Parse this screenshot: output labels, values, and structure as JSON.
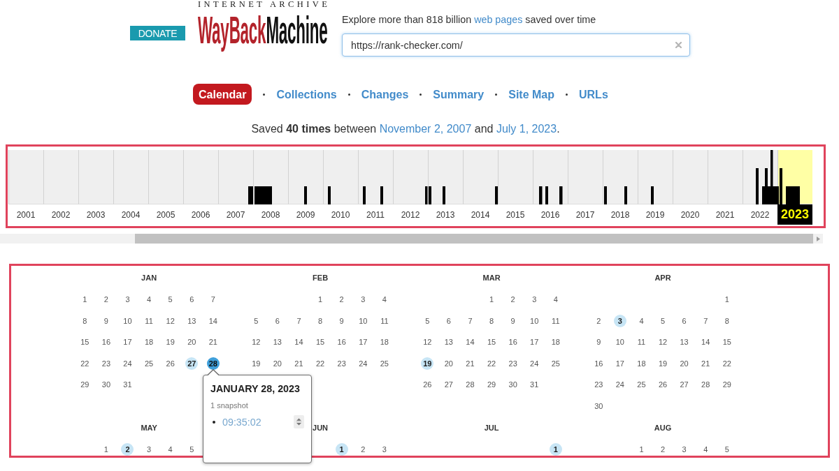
{
  "header": {
    "donate_button": "DONATE",
    "logo": {
      "wordmark": "INTERNET ARCHIVE",
      "name_part_1": "WayBack",
      "name_part_2": "Machine"
    },
    "tagline": [
      {
        "kind": "text",
        "text": "Explore more than 818 billion "
      },
      {
        "kind": "link",
        "text": "web pages"
      },
      {
        "kind": "text",
        "text": " saved over time"
      }
    ],
    "search": {
      "value": "https://rank-checker.com/"
    }
  },
  "tabs": [
    {
      "label": "Calendar",
      "selected": true
    },
    {
      "label": "Collections",
      "selected": false
    },
    {
      "label": "Changes",
      "selected": false
    },
    {
      "label": "Summary",
      "selected": false
    },
    {
      "label": "Site Map",
      "selected": false
    },
    {
      "label": "URLs",
      "selected": false
    }
  ],
  "summary": [
    {
      "kind": "text",
      "text": "Saved **40 times** between "
    },
    {
      "kind": "link",
      "text": "November 2, 2007"
    },
    {
      "kind": "text",
      "text": " and "
    },
    {
      "kind": "link",
      "text": "July 1, 2023"
    },
    {
      "kind": "text",
      "text": "."
    }
  ],
  "timeline": {
    "years": [
      {
        "label": "2001",
        "selected": false
      },
      {
        "label": "2002",
        "selected": false
      },
      {
        "label": "2003",
        "selected": false
      },
      {
        "label": "2004",
        "selected": false
      },
      {
        "label": "2005",
        "selected": false
      },
      {
        "label": "2006",
        "selected": false
      },
      {
        "label": "2007",
        "selected": false
      },
      {
        "label": "2008",
        "selected": false
      },
      {
        "label": "2009",
        "selected": false
      },
      {
        "label": "2010",
        "selected": false
      },
      {
        "label": "2011",
        "selected": false
      },
      {
        "label": "2012",
        "selected": false
      },
      {
        "label": "2013",
        "selected": false
      },
      {
        "label": "2014",
        "selected": false
      },
      {
        "label": "2015",
        "selected": false
      },
      {
        "label": "2016",
        "selected": false
      },
      {
        "label": "2017",
        "selected": false
      },
      {
        "label": "2018",
        "selected": false
      },
      {
        "label": "2019",
        "selected": false
      },
      {
        "label": "2020",
        "selected": false
      },
      {
        "label": "2021",
        "selected": false
      },
      {
        "label": "2022",
        "selected": false
      },
      {
        "label": "2023",
        "selected": true
      }
    ]
  },
  "calendar": {
    "months": [
      {
        "name": "JAN",
        "cells": [
          {
            "kind": "day",
            "day": "1",
            "captured": false,
            "selected": false
          },
          {
            "kind": "day",
            "day": "2",
            "captured": false,
            "selected": false
          },
          {
            "kind": "day",
            "day": "3",
            "captured": false,
            "selected": false
          },
          {
            "kind": "day",
            "day": "4",
            "captured": false,
            "selected": false
          },
          {
            "kind": "day",
            "day": "5",
            "captured": false,
            "selected": false
          },
          {
            "kind": "day",
            "day": "6",
            "captured": false,
            "selected": false
          },
          {
            "kind": "day",
            "day": "7",
            "captured": false,
            "selected": false
          },
          {
            "kind": "day",
            "day": "8",
            "captured": false,
            "selected": false
          },
          {
            "kind": "day",
            "day": "9",
            "captured": false,
            "selected": false
          },
          {
            "kind": "day",
            "day": "10",
            "captured": false,
            "selected": false
          },
          {
            "kind": "day",
            "day": "11",
            "captured": false,
            "selected": false
          },
          {
            "kind": "day",
            "day": "12",
            "captured": false,
            "selected": false
          },
          {
            "kind": "day",
            "day": "13",
            "captured": false,
            "selected": false
          },
          {
            "kind": "day",
            "day": "14",
            "captured": false,
            "selected": false
          },
          {
            "kind": "day",
            "day": "15",
            "captured": false,
            "selected": false
          },
          {
            "kind": "day",
            "day": "16",
            "captured": false,
            "selected": false
          },
          {
            "kind": "day",
            "day": "17",
            "captured": false,
            "selected": false
          },
          {
            "kind": "day",
            "day": "18",
            "captured": false,
            "selected": false
          },
          {
            "kind": "day",
            "day": "19",
            "captured": false,
            "selected": false
          },
          {
            "kind": "day",
            "day": "20",
            "captured": false,
            "selected": false
          },
          {
            "kind": "day",
            "day": "21",
            "captured": false,
            "selected": false
          },
          {
            "kind": "day",
            "day": "22",
            "captured": false,
            "selected": false
          },
          {
            "kind": "day",
            "day": "23",
            "captured": false,
            "selected": false
          },
          {
            "kind": "day",
            "day": "24",
            "captured": false,
            "selected": false
          },
          {
            "kind": "day",
            "day": "25",
            "captured": false,
            "selected": false
          },
          {
            "kind": "day",
            "day": "26",
            "captured": false,
            "selected": false
          },
          {
            "kind": "day",
            "day": "27",
            "captured": true,
            "selected": false
          },
          {
            "kind": "day",
            "day": "28",
            "captured": true,
            "selected": true
          },
          {
            "kind": "day",
            "day": "29",
            "captured": false,
            "selected": false
          },
          {
            "kind": "day",
            "day": "30",
            "captured": false,
            "selected": false
          },
          {
            "kind": "day",
            "day": "31",
            "captured": false,
            "selected": false
          }
        ]
      },
      {
        "name": "FEB",
        "cells": [
          {
            "kind": "blank"
          },
          {
            "kind": "blank"
          },
          {
            "kind": "blank"
          },
          {
            "kind": "day",
            "day": "1",
            "captured": false,
            "selected": false
          },
          {
            "kind": "day",
            "day": "2",
            "captured": false,
            "selected": false
          },
          {
            "kind": "day",
            "day": "3",
            "captured": false,
            "selected": false
          },
          {
            "kind": "day",
            "day": "4",
            "captured": false,
            "selected": false
          },
          {
            "kind": "day",
            "day": "5",
            "captured": false,
            "selected": false
          },
          {
            "kind": "day",
            "day": "6",
            "captured": false,
            "selected": false
          },
          {
            "kind": "day",
            "day": "7",
            "captured": false,
            "selected": false
          },
          {
            "kind": "day",
            "day": "8",
            "captured": false,
            "selected": false
          },
          {
            "kind": "day",
            "day": "9",
            "captured": false,
            "selected": false
          },
          {
            "kind": "day",
            "day": "10",
            "captured": false,
            "selected": false
          },
          {
            "kind": "day",
            "day": "11",
            "captured": false,
            "selected": false
          },
          {
            "kind": "day",
            "day": "12",
            "captured": false,
            "selected": false
          },
          {
            "kind": "day",
            "day": "13",
            "captured": false,
            "selected": false
          },
          {
            "kind": "day",
            "day": "14",
            "captured": false,
            "selected": false
          },
          {
            "kind": "day",
            "day": "15",
            "captured": false,
            "selected": false
          },
          {
            "kind": "day",
            "day": "16",
            "captured": false,
            "selected": false
          },
          {
            "kind": "day",
            "day": "17",
            "captured": false,
            "selected": false
          },
          {
            "kind": "day",
            "day": "18",
            "captured": false,
            "selected": false
          },
          {
            "kind": "day",
            "day": "19",
            "captured": false,
            "selected": false
          },
          {
            "kind": "day",
            "day": "20",
            "captured": false,
            "selected": false
          },
          {
            "kind": "day",
            "day": "21",
            "captured": false,
            "selected": false
          },
          {
            "kind": "day",
            "day": "22",
            "captured": false,
            "selected": false
          },
          {
            "kind": "day",
            "day": "23",
            "captured": false,
            "selected": false
          },
          {
            "kind": "day",
            "day": "24",
            "captured": false,
            "selected": false
          },
          {
            "kind": "day",
            "day": "25",
            "captured": false,
            "selected": false
          }
        ]
      },
      {
        "name": "MAR",
        "cells": [
          {
            "kind": "blank"
          },
          {
            "kind": "blank"
          },
          {
            "kind": "blank"
          },
          {
            "kind": "day",
            "day": "1",
            "captured": false,
            "selected": false
          },
          {
            "kind": "day",
            "day": "2",
            "captured": false,
            "selected": false
          },
          {
            "kind": "day",
            "day": "3",
            "captured": false,
            "selected": false
          },
          {
            "kind": "day",
            "day": "4",
            "captured": false,
            "selected": false
          },
          {
            "kind": "day",
            "day": "5",
            "captured": false,
            "selected": false
          },
          {
            "kind": "day",
            "day": "6",
            "captured": false,
            "selected": false
          },
          {
            "kind": "day",
            "day": "7",
            "captured": false,
            "selected": false
          },
          {
            "kind": "day",
            "day": "8",
            "captured": false,
            "selected": false
          },
          {
            "kind": "day",
            "day": "9",
            "captured": false,
            "selected": false
          },
          {
            "kind": "day",
            "day": "10",
            "captured": false,
            "selected": false
          },
          {
            "kind": "day",
            "day": "11",
            "captured": false,
            "selected": false
          },
          {
            "kind": "day",
            "day": "12",
            "captured": false,
            "selected": false
          },
          {
            "kind": "day",
            "day": "13",
            "captured": false,
            "selected": false
          },
          {
            "kind": "day",
            "day": "14",
            "captured": false,
            "selected": false
          },
          {
            "kind": "day",
            "day": "15",
            "captured": false,
            "selected": false
          },
          {
            "kind": "day",
            "day": "16",
            "captured": false,
            "selected": false
          },
          {
            "kind": "day",
            "day": "17",
            "captured": false,
            "selected": false
          },
          {
            "kind": "day",
            "day": "18",
            "captured": false,
            "selected": false
          },
          {
            "kind": "day",
            "day": "19",
            "captured": true,
            "selected": false
          },
          {
            "kind": "day",
            "day": "20",
            "captured": false,
            "selected": false
          },
          {
            "kind": "day",
            "day": "21",
            "captured": false,
            "selected": false
          },
          {
            "kind": "day",
            "day": "22",
            "captured": false,
            "selected": false
          },
          {
            "kind": "day",
            "day": "23",
            "captured": false,
            "selected": false
          },
          {
            "kind": "day",
            "day": "24",
            "captured": false,
            "selected": false
          },
          {
            "kind": "day",
            "day": "25",
            "captured": false,
            "selected": false
          },
          {
            "kind": "day",
            "day": "26",
            "captured": false,
            "selected": false
          },
          {
            "kind": "day",
            "day": "27",
            "captured": false,
            "selected": false
          },
          {
            "kind": "day",
            "day": "28",
            "captured": false,
            "selected": false
          },
          {
            "kind": "day",
            "day": "29",
            "captured": false,
            "selected": false
          },
          {
            "kind": "day",
            "day": "30",
            "captured": false,
            "selected": false
          },
          {
            "kind": "day",
            "day": "31",
            "captured": false,
            "selected": false
          }
        ]
      },
      {
        "name": "APR",
        "cells": [
          {
            "kind": "blank"
          },
          {
            "kind": "blank"
          },
          {
            "kind": "blank"
          },
          {
            "kind": "blank"
          },
          {
            "kind": "blank"
          },
          {
            "kind": "blank"
          },
          {
            "kind": "day",
            "day": "1",
            "captured": false,
            "selected": false
          },
          {
            "kind": "day",
            "day": "2",
            "captured": false,
            "selected": false
          },
          {
            "kind": "day",
            "day": "3",
            "captured": true,
            "selected": false
          },
          {
            "kind": "day",
            "day": "4",
            "captured": false,
            "selected": false
          },
          {
            "kind": "day",
            "day": "5",
            "captured": false,
            "selected": false
          },
          {
            "kind": "day",
            "day": "6",
            "captured": false,
            "selected": false
          },
          {
            "kind": "day",
            "day": "7",
            "captured": false,
            "selected": false
          },
          {
            "kind": "day",
            "day": "8",
            "captured": false,
            "selected": false
          },
          {
            "kind": "day",
            "day": "9",
            "captured": false,
            "selected": false
          },
          {
            "kind": "day",
            "day": "10",
            "captured": false,
            "selected": false
          },
          {
            "kind": "day",
            "day": "11",
            "captured": false,
            "selected": false
          },
          {
            "kind": "day",
            "day": "12",
            "captured": false,
            "selected": false
          },
          {
            "kind": "day",
            "day": "13",
            "captured": false,
            "selected": false
          },
          {
            "kind": "day",
            "day": "14",
            "captured": false,
            "selected": false
          },
          {
            "kind": "day",
            "day": "15",
            "captured": false,
            "selected": false
          },
          {
            "kind": "day",
            "day": "16",
            "captured": false,
            "selected": false
          },
          {
            "kind": "day",
            "day": "17",
            "captured": false,
            "selected": false
          },
          {
            "kind": "day",
            "day": "18",
            "captured": false,
            "selected": false
          },
          {
            "kind": "day",
            "day": "19",
            "captured": false,
            "selected": false
          },
          {
            "kind": "day",
            "day": "20",
            "captured": false,
            "selected": false
          },
          {
            "kind": "day",
            "day": "21",
            "captured": false,
            "selected": false
          },
          {
            "kind": "day",
            "day": "22",
            "captured": false,
            "selected": false
          },
          {
            "kind": "day",
            "day": "23",
            "captured": false,
            "selected": false
          },
          {
            "kind": "day",
            "day": "24",
            "captured": false,
            "selected": false
          },
          {
            "kind": "day",
            "day": "25",
            "captured": false,
            "selected": false
          },
          {
            "kind": "day",
            "day": "26",
            "captured": false,
            "selected": false
          },
          {
            "kind": "day",
            "day": "27",
            "captured": false,
            "selected": false
          },
          {
            "kind": "day",
            "day": "28",
            "captured": false,
            "selected": false
          },
          {
            "kind": "day",
            "day": "29",
            "captured": false,
            "selected": false
          },
          {
            "kind": "day",
            "day": "30",
            "captured": false,
            "selected": false
          }
        ]
      },
      {
        "name": "MAY",
        "cells": [
          {
            "kind": "blank"
          },
          {
            "kind": "day",
            "day": "1",
            "captured": false,
            "selected": false
          },
          {
            "kind": "day",
            "day": "2",
            "captured": true,
            "selected": false
          },
          {
            "kind": "day",
            "day": "3",
            "captured": false,
            "selected": false
          },
          {
            "kind": "day",
            "day": "4",
            "captured": false,
            "selected": false
          },
          {
            "kind": "day",
            "day": "5",
            "captured": false,
            "selected": false
          }
        ]
      },
      {
        "name": "JUN",
        "cells": [
          {
            "kind": "blank"
          },
          {
            "kind": "blank"
          },
          {
            "kind": "blank"
          },
          {
            "kind": "blank"
          },
          {
            "kind": "day",
            "day": "1",
            "captured": true,
            "selected": false
          },
          {
            "kind": "day",
            "day": "2",
            "captured": false,
            "selected": false
          },
          {
            "kind": "day",
            "day": "3",
            "captured": false,
            "selected": false
          }
        ]
      },
      {
        "name": "JUL",
        "cells": [
          {
            "kind": "blank"
          },
          {
            "kind": "blank"
          },
          {
            "kind": "blank"
          },
          {
            "kind": "blank"
          },
          {
            "kind": "blank"
          },
          {
            "kind": "blank"
          },
          {
            "kind": "day",
            "day": "1",
            "captured": true,
            "selected": false
          }
        ]
      },
      {
        "name": "AUG",
        "cells": [
          {
            "kind": "blank"
          },
          {
            "kind": "blank"
          },
          {
            "kind": "day",
            "day": "1",
            "captured": false,
            "selected": false
          },
          {
            "kind": "day",
            "day": "2",
            "captured": false,
            "selected": false
          },
          {
            "kind": "day",
            "day": "3",
            "captured": false,
            "selected": false
          },
          {
            "kind": "day",
            "day": "4",
            "captured": false,
            "selected": false
          },
          {
            "kind": "day",
            "day": "5",
            "captured": false,
            "selected": false
          }
        ]
      }
    ],
    "tooltip": {
      "title": "JANUARY 28, 2023",
      "count": "1 snapshot",
      "times": [
        "09:35:02"
      ]
    }
  }
}
